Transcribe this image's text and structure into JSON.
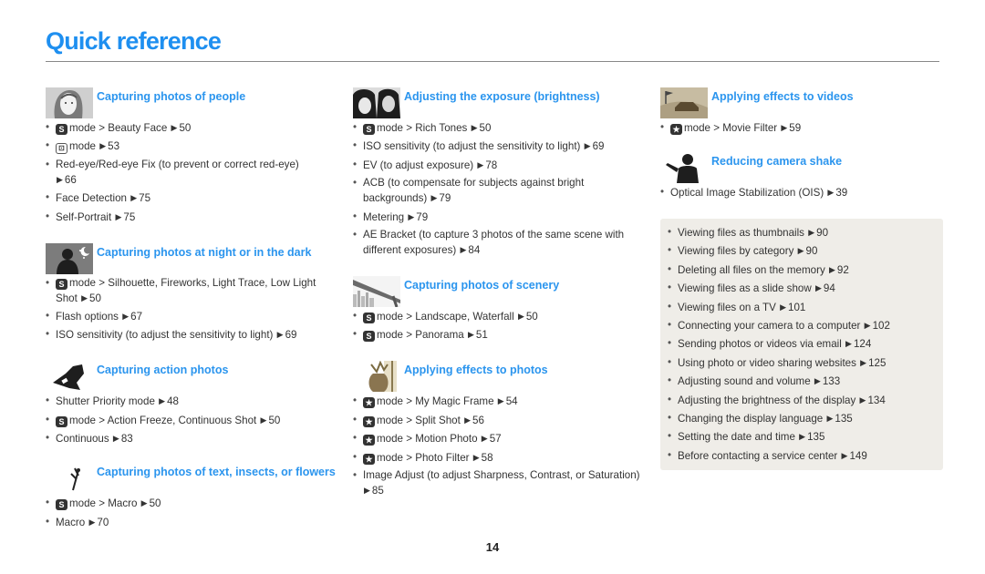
{
  "header": {
    "title": "Quick reference"
  },
  "page_number": "14",
  "columns": [
    {
      "sections": [
        {
          "title": "Capturing photos of people",
          "icon": "portrait-woman-thumbnail",
          "items": [
            {
              "mode_icon": "S",
              "text": "mode > Beauty Face",
              "page": "50"
            },
            {
              "mode_icon": "portrait-frame",
              "text": "mode",
              "page": "53"
            },
            {
              "text": "Red-eye/Red-eye Fix (to prevent or correct red-eye)",
              "page": "66"
            },
            {
              "text": "Face Detection",
              "page": "75"
            },
            {
              "text": "Self-Portrait",
              "page": "75"
            }
          ]
        },
        {
          "title": "Capturing photos at night or in the dark",
          "icon": "night-silhouette-thumbnail",
          "items": [
            {
              "mode_icon": "S",
              "text": "mode > Silhouette, Fireworks, Light Trace, Low Light Shot",
              "page": "50"
            },
            {
              "text": "Flash options",
              "page": "67"
            },
            {
              "text": "ISO sensitivity (to adjust the sensitivity to light)",
              "page": "69"
            }
          ]
        },
        {
          "title": "Capturing action photos",
          "icon": "snowboarder-thumbnail",
          "items": [
            {
              "text": "Shutter Priority mode",
              "page": "48"
            },
            {
              "mode_icon": "S",
              "text": "mode > Action Freeze, Continuous Shot",
              "page": "50"
            },
            {
              "text": "Continuous",
              "page": "83"
            }
          ]
        },
        {
          "title": "Capturing photos of text, insects, or flowers",
          "icon": "flower-thumbnail",
          "items": [
            {
              "mode_icon": "S",
              "text": "mode > Macro",
              "page": "50"
            },
            {
              "text": "Macro",
              "page": "70"
            }
          ]
        }
      ]
    },
    {
      "sections": [
        {
          "title": "Adjusting the exposure (brightness)",
          "icon": "couple-faces-thumbnail",
          "items": [
            {
              "mode_icon": "S",
              "text": "mode > Rich Tones",
              "page": "50"
            },
            {
              "text": "ISO sensitivity (to adjust the sensitivity to light)",
              "page": "69"
            },
            {
              "text": "EV (to adjust exposure)",
              "page": "78"
            },
            {
              "text": "ACB (to compensate for subjects against bright backgrounds)",
              "page": "79"
            },
            {
              "text": "Metering",
              "page": "79"
            },
            {
              "text": "AE Bracket (to capture 3 photos of the same scene with different exposures)",
              "page": "84"
            }
          ]
        },
        {
          "title": "Capturing photos of scenery",
          "icon": "bridge-skyline-thumbnail",
          "items": [
            {
              "mode_icon": "S",
              "text": "mode > Landscape, Waterfall",
              "page": "50"
            },
            {
              "mode_icon": "S",
              "text": "mode > Panorama",
              "page": "51"
            }
          ]
        },
        {
          "title": "Applying effects to photos",
          "icon": "vase-thumbnail",
          "items": [
            {
              "mode_icon": "star",
              "text": "mode > My Magic Frame",
              "page": "54"
            },
            {
              "mode_icon": "star",
              "text": "mode > Split Shot",
              "page": "56"
            },
            {
              "mode_icon": "star",
              "text": "mode > Motion Photo",
              "page": "57"
            },
            {
              "mode_icon": "star",
              "text": "mode > Photo Filter",
              "page": "58"
            },
            {
              "text": "Image Adjust (to adjust Sharpness, Contrast, or Saturation)",
              "page": "85"
            }
          ]
        }
      ]
    },
    {
      "sections": [
        {
          "title": "Applying effects to videos",
          "icon": "race-car-thumbnail",
          "items": [
            {
              "mode_icon": "star",
              "text": "mode > Movie Filter",
              "page": "59"
            }
          ]
        },
        {
          "title": "Reducing camera shake",
          "icon": "shaky-person-thumbnail",
          "items": [
            {
              "text": "Optical Image Stabilization (OIS)",
              "page": "39"
            }
          ]
        }
      ],
      "box_items": [
        {
          "text": "Viewing files as thumbnails",
          "page": "90"
        },
        {
          "text": "Viewing files by category",
          "page": "90"
        },
        {
          "text": "Deleting all files on the memory",
          "page": "92"
        },
        {
          "text": "Viewing files as a slide show",
          "page": "94"
        },
        {
          "text": "Viewing files on a TV",
          "page": "101"
        },
        {
          "text": "Connecting your camera to a computer",
          "page": "102"
        },
        {
          "text": "Sending photos or videos via email",
          "page": "124"
        },
        {
          "text": "Using photo or video sharing websites",
          "page": "125"
        },
        {
          "text": "Adjusting sound and volume",
          "page": "133"
        },
        {
          "text": "Adjusting the brightness of the display",
          "page": "134"
        },
        {
          "text": "Changing the display language",
          "page": "135"
        },
        {
          "text": "Setting the date and time",
          "page": "135"
        },
        {
          "text": "Before contacting a service center",
          "page": "149"
        }
      ]
    }
  ],
  "glyphs": {
    "arrow": "▶",
    "star_mode": "★",
    "scene_mode": "S",
    "portrait_mode": "⊡"
  }
}
